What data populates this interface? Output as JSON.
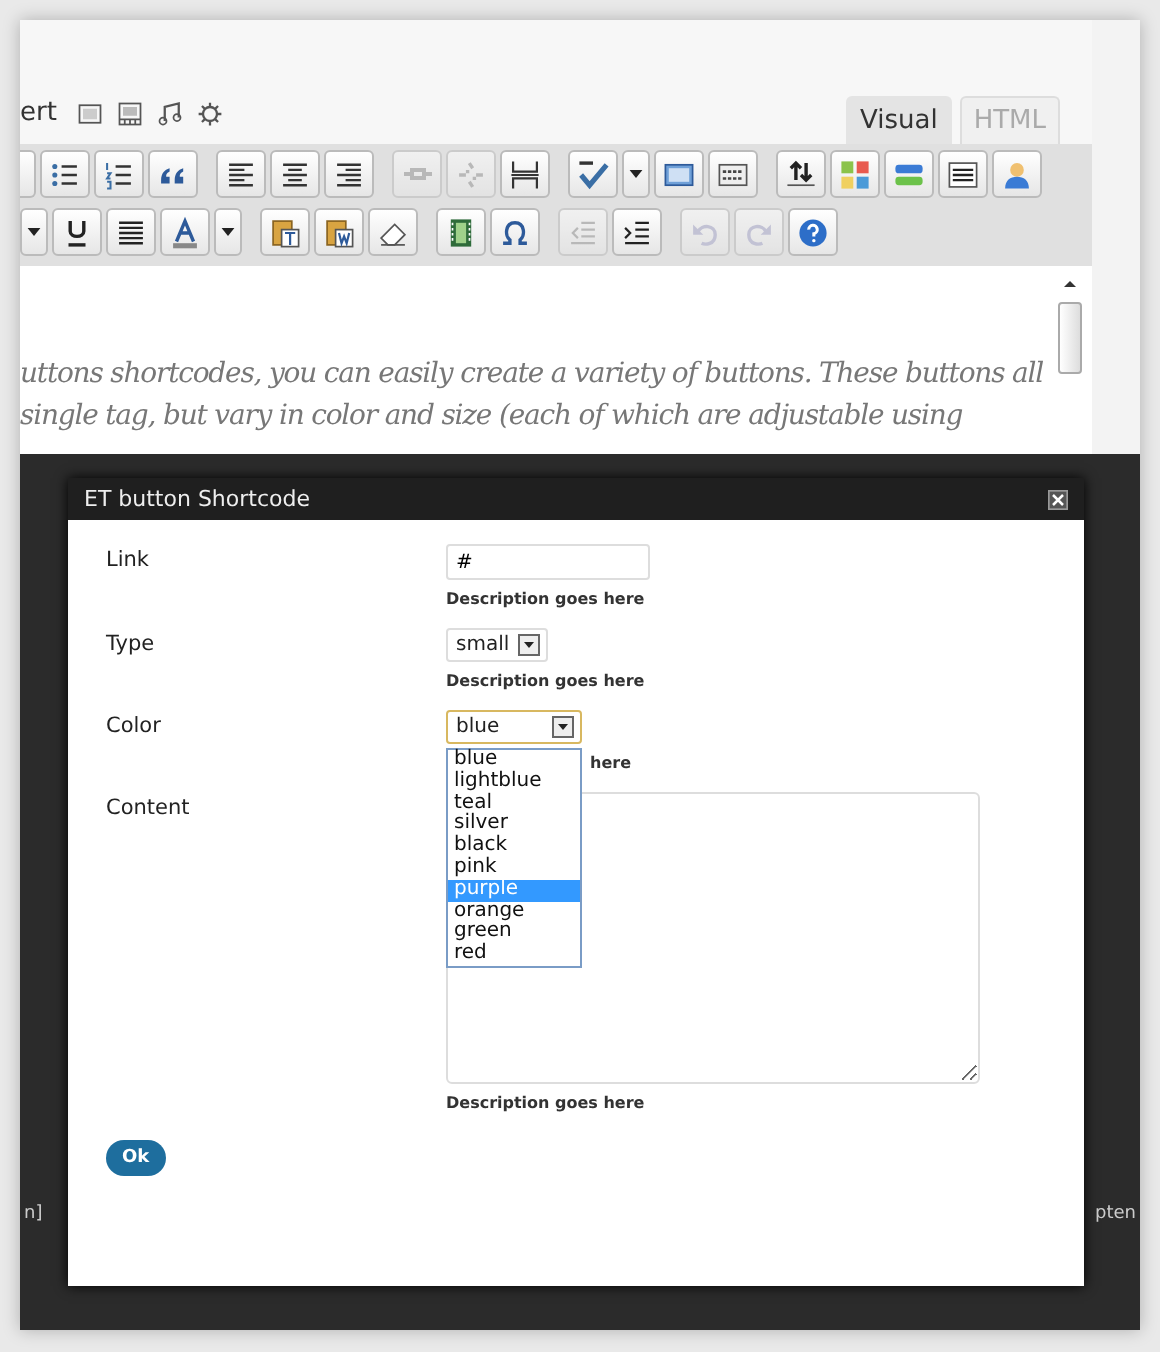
{
  "editor": {
    "insert_label": "ert",
    "media_icons": [
      {
        "kind": "image"
      },
      {
        "kind": "video"
      },
      {
        "kind": "audio"
      },
      {
        "kind": "gear"
      }
    ],
    "tabs": [
      {
        "label": "Visual",
        "selected": true
      },
      {
        "label": "HTML",
        "selected": false
      }
    ],
    "toolbar_rows": [
      [
        {
          "kind": "partial",
          "disabled": false
        },
        {
          "kind": "bullets",
          "disabled": false
        },
        {
          "kind": "numbers",
          "disabled": false
        },
        {
          "kind": "quote",
          "disabled": false
        },
        {
          "kind": "sep"
        },
        {
          "kind": "align-left",
          "disabled": false
        },
        {
          "kind": "align-center",
          "disabled": false
        },
        {
          "kind": "align-right",
          "disabled": false
        },
        {
          "kind": "sep"
        },
        {
          "kind": "link",
          "disabled": true
        },
        {
          "kind": "unlink",
          "disabled": true
        },
        {
          "kind": "more",
          "disabled": false
        },
        {
          "kind": "sep"
        },
        {
          "kind": "spell",
          "disabled": false
        },
        {
          "kind": "caret",
          "disabled": false
        },
        {
          "kind": "fullscreen",
          "disabled": false
        },
        {
          "kind": "kitchen",
          "disabled": false
        },
        {
          "kind": "sep"
        },
        {
          "kind": "upload",
          "disabled": false
        },
        {
          "kind": "grid",
          "disabled": false
        },
        {
          "kind": "stripes",
          "disabled": false
        },
        {
          "kind": "lines",
          "disabled": false
        },
        {
          "kind": "person",
          "disabled": false
        }
      ],
      [
        {
          "kind": "caret",
          "disabled": false
        },
        {
          "kind": "underline",
          "disabled": false
        },
        {
          "kind": "justify",
          "disabled": false
        },
        {
          "kind": "text-color",
          "disabled": false
        },
        {
          "kind": "caret",
          "disabled": false
        },
        {
          "kind": "sep"
        },
        {
          "kind": "paste-text",
          "disabled": false
        },
        {
          "kind": "paste-word",
          "disabled": false
        },
        {
          "kind": "eraser",
          "disabled": false
        },
        {
          "kind": "sep"
        },
        {
          "kind": "film",
          "disabled": false
        },
        {
          "kind": "omega",
          "disabled": false
        },
        {
          "kind": "sep"
        },
        {
          "kind": "outdent",
          "disabled": true
        },
        {
          "kind": "indent",
          "disabled": false
        },
        {
          "kind": "sep"
        },
        {
          "kind": "undo",
          "disabled": true
        },
        {
          "kind": "redo",
          "disabled": true
        },
        {
          "kind": "help",
          "disabled": false
        }
      ]
    ],
    "content_lines": [
      "uttons shortcodes, you can easily create a variety of buttons. These buttons all",
      "single tag, but vary in color and size (each of which are adjustable using"
    ]
  },
  "background_fragments": [
    "n]",
    "pten"
  ],
  "dialog": {
    "title": "ET button Shortcode",
    "fields": [
      {
        "kind": "text",
        "label": "Link",
        "value": "#",
        "description": "Description goes here"
      },
      {
        "kind": "select",
        "label": "Type",
        "value": "small",
        "description": "Description goes here"
      },
      {
        "kind": "select",
        "label": "Color",
        "value": "blue",
        "description": "here",
        "open": true,
        "options": [
          {
            "label": "blue",
            "highlighted": false
          },
          {
            "label": "lightblue",
            "highlighted": false
          },
          {
            "label": "teal",
            "highlighted": false
          },
          {
            "label": "silver",
            "highlighted": false
          },
          {
            "label": "black",
            "highlighted": false
          },
          {
            "label": "pink",
            "highlighted": false
          },
          {
            "label": "purple",
            "highlighted": true
          },
          {
            "label": "orange",
            "highlighted": false
          },
          {
            "label": "green",
            "highlighted": false
          },
          {
            "label": "red",
            "highlighted": false
          }
        ]
      },
      {
        "kind": "textarea",
        "label": "Content",
        "description": "Description goes here"
      }
    ],
    "ok_button": "Ok"
  }
}
